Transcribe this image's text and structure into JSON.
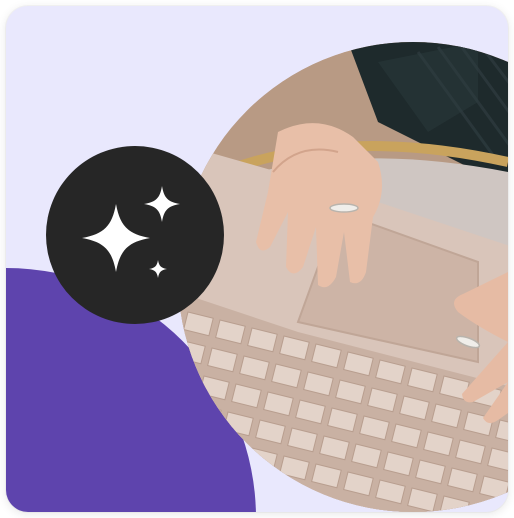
{
  "card": {
    "background_color": "#e9e8fd",
    "accent_color": "#5e44ad",
    "badge_color": "#262626"
  },
  "badge": {
    "icon": "sparkles-icon"
  },
  "photo": {
    "subject": "hands-typing-on-laptop-illustration"
  }
}
